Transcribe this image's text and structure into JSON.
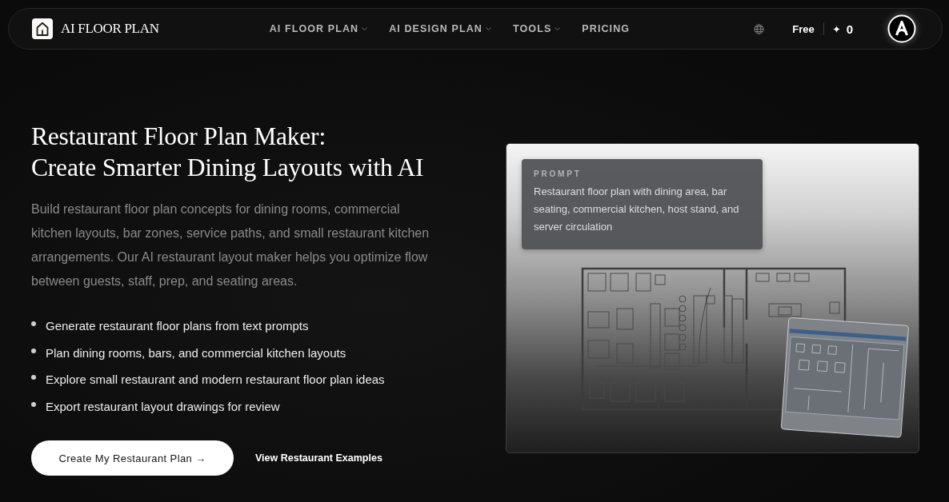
{
  "nav": {
    "brand": "AI FLOOR PLAN",
    "links": [
      {
        "label": "AI FLOOR PLAN",
        "dropdown": true
      },
      {
        "label": "AI DESIGN PLAN",
        "dropdown": true
      },
      {
        "label": "TOOLS",
        "dropdown": true
      },
      {
        "label": "PRICING",
        "dropdown": false
      }
    ],
    "plan": "Free",
    "credits": "0"
  },
  "hero": {
    "title_lines": [
      "Restaurant Floor Plan Maker:",
      "Create Smarter Dining Layouts with AI"
    ],
    "description": "Build restaurant floor plan concepts for dining rooms, commercial kitchen layouts, bar zones, service paths, and small restaurant kitchen arrangements. Our AI restaurant layout maker helps you optimize flow between guests, staff, prep, and seating areas.",
    "features": [
      "Generate restaurant floor plans from text prompts",
      "Plan dining rooms, bars, and commercial kitchen layouts",
      "Explore small restaurant and modern restaurant floor plan ideas",
      "Export restaurant layout drawings for review"
    ],
    "primary_button": "Create My Restaurant Plan →",
    "secondary_link": "View Restaurant Examples"
  },
  "preview": {
    "prompt_label": "PROMPT",
    "prompt_text": "Restaurant floor plan with dining area, bar seating, commercial kitchen, host stand, and server circulation"
  }
}
